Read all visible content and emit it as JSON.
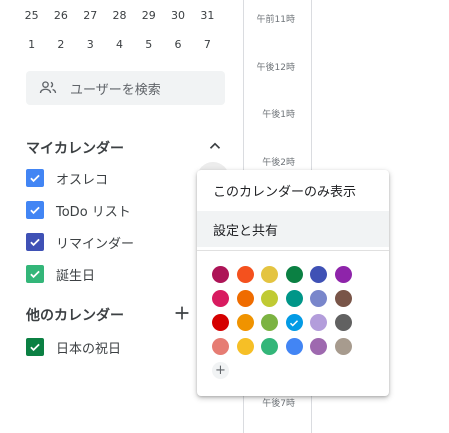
{
  "mini_calendar": {
    "row1": [
      "25",
      "26",
      "27",
      "28",
      "29",
      "30",
      "31"
    ],
    "row2": [
      "1",
      "2",
      "3",
      "4",
      "5",
      "6",
      "7"
    ]
  },
  "search": {
    "placeholder": "ユーザーを検索",
    "icon": "people-icon"
  },
  "my_calendars": {
    "title": "マイカレンダー",
    "items": [
      {
        "label": "オスレコ",
        "color": "#4285f4"
      },
      {
        "label": "ToDo リスト",
        "color": "#4285f4"
      },
      {
        "label": "リマインダー",
        "color": "#3f51b5"
      },
      {
        "label": "誕生日",
        "color": "#33b679"
      }
    ]
  },
  "other_calendars": {
    "title": "他のカレンダー",
    "items": [
      {
        "label": "日本の祝日",
        "color": "#0b8043"
      }
    ]
  },
  "time_labels": [
    "午前11時",
    "午後12時",
    "午後1時",
    "午後2時",
    "午後7時"
  ],
  "menu": {
    "items": [
      "このカレンダーのみ表示",
      "設定と共有"
    ],
    "colors": [
      [
        "#ad1457",
        "#f4511e",
        "#e4c441",
        "#0b8043",
        "#3f51b5",
        "#8e24aa"
      ],
      [
        "#d81b60",
        "#ef6c00",
        "#c0ca33",
        "#009688",
        "#7986cb",
        "#795548"
      ],
      [
        "#d50000",
        "#f09300",
        "#7cb342",
        "#039be5",
        "#b39ddb",
        "#616161"
      ],
      [
        "#e67c73",
        "#f6bf26",
        "#33b679",
        "#4285f4",
        "#9e69af",
        "#a79b8e"
      ]
    ],
    "selected_color": "#039be5",
    "add_color_label": "+"
  }
}
